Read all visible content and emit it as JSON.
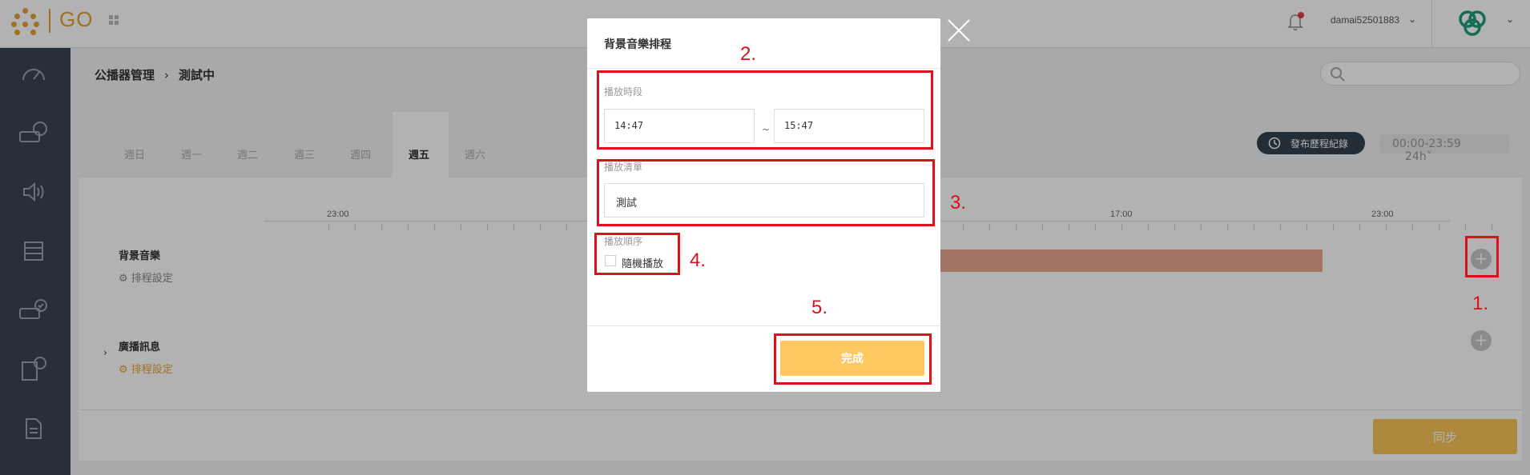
{
  "topbar": {
    "logo_text": "GO",
    "username": "damai52501883"
  },
  "breadcrumb": {
    "parent": "公播器管理",
    "current": "測試中"
  },
  "tabs": [
    "週日",
    "週一",
    "週二",
    "週三",
    "週四",
    "週五",
    "週六"
  ],
  "active_tab": "週五",
  "toolbar": {
    "history_label": "發布歷程紀錄",
    "range_label": "00:00-23:59",
    "mode_label": "24h"
  },
  "ruler": {
    "labels": [
      "23:00",
      "17:00",
      "23:00"
    ]
  },
  "rows": {
    "bgm_title": "背景音樂",
    "bgm_sub": "排程設定",
    "broadcast_title": "廣播訊息",
    "broadcast_sub": "排程設定"
  },
  "sync_label": "同步",
  "modal": {
    "title": "背景音樂排程",
    "time_label": "播放時段",
    "start_time": "14:47",
    "tilde": "~",
    "end_time": "15:47",
    "playlist_label": "播放清單",
    "playlist_value": "測試",
    "order_label": "播放順序",
    "shuffle_label": "隨機播放",
    "shuffle_checked": false,
    "done_label": "完成"
  },
  "annotations": [
    "1.",
    "2.",
    "3.",
    "4.",
    "5."
  ],
  "colors": {
    "accent": "#e8a033",
    "sidebar": "#3a4452",
    "done_button": "#fec75f",
    "annotation_red": "#d9121b",
    "timeline_bar": "#e8a78e"
  }
}
